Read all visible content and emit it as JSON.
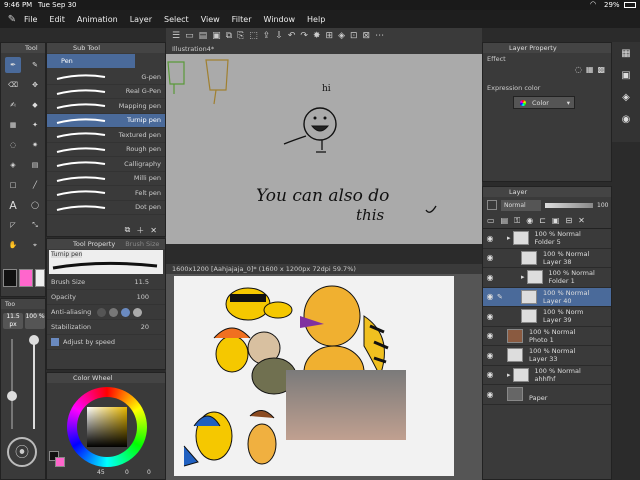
{
  "status": {
    "time": "9:46 PM",
    "date": "Tue Sep 30",
    "battery": "29%"
  },
  "menu": [
    "File",
    "Edit",
    "Animation",
    "Layer",
    "Select",
    "View",
    "Filter",
    "Window",
    "Help"
  ],
  "tool_panel": {
    "title": "Tool",
    "subtool_title": "Sub Tool",
    "subtool_group": "Pen"
  },
  "brushes": [
    "G-pen",
    "Real G-Pen",
    "Mapping pen",
    "Turnip pen",
    "Textured pen",
    "Rough pen",
    "Calligraphy",
    "Milli pen",
    "Felt pen",
    "Dot pen"
  ],
  "selected_brush_index": 3,
  "tool_property": {
    "title": "Tool Property",
    "title2": "Brush Size",
    "brush_name": "Turnip pen",
    "brush_size_label": "Brush Size",
    "brush_size_value": "11.5",
    "opacity_label": "Opacity",
    "opacity_value": "100",
    "antialias_label": "Anti-aliasing",
    "stabilization_label": "Stabilization",
    "stabilization_value": "20",
    "adjust_speed_label": "Adjust by speed"
  },
  "left_sliders": {
    "size_value": "11.5 px",
    "opacity_value": "100 %"
  },
  "color_wheel": {
    "title": "Color Wheel",
    "values": "45",
    "v2": "0",
    "v3": "0"
  },
  "colors": {
    "accent": "#4a6a9a",
    "main_color": "#111111",
    "sub_color": "#ff66cc"
  },
  "canvas1": {
    "tab": "Illustration4*",
    "text_hi": "hi",
    "text_also": "You can also do",
    "text_this": "this"
  },
  "canvas2": {
    "tab": "1600x1200 [Aahjajaja_0]* (1600 x 1200px 72dpi 59.7%)"
  },
  "layer_property": {
    "title": "Layer Property",
    "effect_label": "Effect",
    "expression_label": "Expression color",
    "expression_value": "Color"
  },
  "layer_panel": {
    "title": "Layer",
    "blend_mode": "Normal",
    "opacity": "100",
    "layers": [
      {
        "pct": "100 %",
        "mode": "Normal",
        "name": "Folder 5",
        "type": "folder",
        "indent": 0
      },
      {
        "pct": "100 %",
        "mode": "Normal",
        "name": "Layer 38",
        "type": "layer",
        "indent": 1
      },
      {
        "pct": "100 %",
        "mode": "Normal",
        "name": "Folder 1",
        "type": "folder",
        "indent": 1
      },
      {
        "pct": "100 %",
        "mode": "Normal",
        "name": "Layer 40",
        "type": "layer",
        "indent": 1
      },
      {
        "pct": "100 %",
        "mode": "Norm",
        "name": "Layer 39",
        "type": "layer",
        "indent": 1
      },
      {
        "pct": "100 %",
        "mode": "Normal",
        "name": "Photo 1",
        "type": "photo",
        "indent": 0
      },
      {
        "pct": "100 %",
        "mode": "Normal",
        "name": "Layer 33",
        "type": "layer",
        "indent": 0
      },
      {
        "pct": "100 %",
        "mode": "Normal",
        "name": "ahhfhf",
        "type": "folder",
        "indent": 0
      },
      {
        "pct": "",
        "mode": "",
        "name": "Paper",
        "type": "paper",
        "indent": 0
      }
    ],
    "selected_index": 3
  }
}
